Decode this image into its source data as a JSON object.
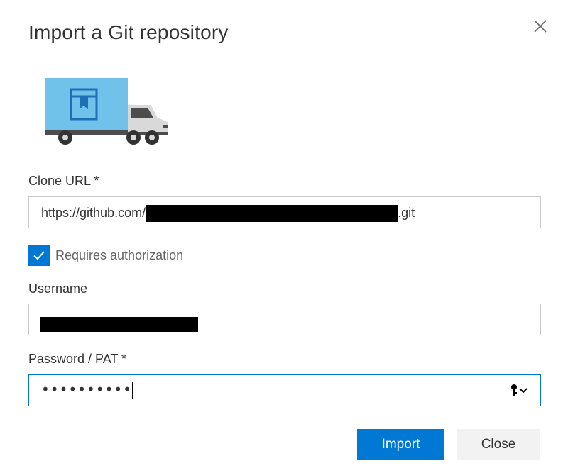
{
  "dialog": {
    "title": "Import a Git repository",
    "close_icon": "close-icon"
  },
  "illustration": {
    "icon": "truck-illustration",
    "accent_color": "#71c2ea"
  },
  "clone_url": {
    "label": "Clone URL *",
    "value_prefix": "https://github.com/",
    "value_suffix": ".git"
  },
  "auth": {
    "checkbox_label": "Requires authorization",
    "checked": true
  },
  "username": {
    "label": "Username"
  },
  "password": {
    "label": "Password / PAT *",
    "masked_value": "••••••••••",
    "reveal_icon": "key-icon"
  },
  "actions": {
    "import_label": "Import",
    "close_label": "Close"
  },
  "colors": {
    "accent": "#0078d4",
    "secondary_button": "#f2f2f2",
    "border": "#c8c8c8"
  }
}
